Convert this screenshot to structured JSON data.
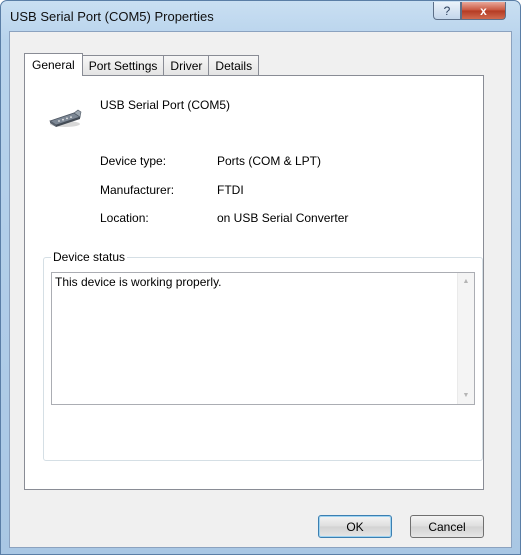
{
  "window": {
    "title": "USB Serial Port (COM5) Properties",
    "help_label": "?",
    "close_label": "x"
  },
  "tabs": [
    {
      "label": "General",
      "active": true
    },
    {
      "label": "Port Settings",
      "active": false
    },
    {
      "label": "Driver",
      "active": false
    },
    {
      "label": "Details",
      "active": false
    }
  ],
  "general": {
    "device_name": "USB Serial Port (COM5)",
    "device_icon": "usb-serial-connector-icon",
    "info": [
      {
        "label": "Device type:",
        "value": "Ports (COM & LPT)"
      },
      {
        "label": "Manufacturer:",
        "value": "FTDI"
      },
      {
        "label": "Location:",
        "value": "on USB Serial Converter"
      }
    ],
    "status_group_label": "Device status",
    "status_text": "This device is working properly."
  },
  "buttons": {
    "ok_label": "OK",
    "cancel_label": "Cancel"
  }
}
